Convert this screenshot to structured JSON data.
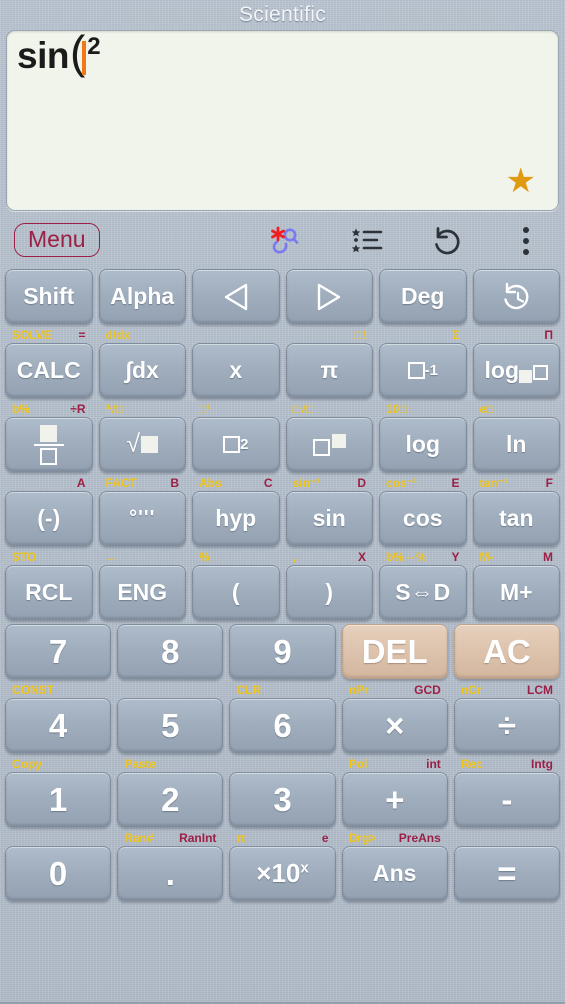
{
  "app": {
    "title": "Scientific"
  },
  "display": {
    "expression_function": "sin",
    "expression_paren": "(",
    "expression_superscript": "2",
    "cursor": "|",
    "star_icon": "star-icon",
    "star_glyph": "★",
    "background_color": "#f0f4ea",
    "star_color": "#e09a10",
    "cursor_color": "#f07818"
  },
  "toolbar": {
    "menu_label": "Menu",
    "menu_color": "#9c1f45",
    "icons": [
      {
        "name": "search-formula-icon",
        "label": "Search"
      },
      {
        "name": "list-icon",
        "label": "List"
      },
      {
        "name": "undo-icon",
        "label": "Undo"
      },
      {
        "name": "more-options-icon",
        "label": "More"
      }
    ]
  },
  "colors": {
    "shift_label": "#f0c418",
    "alpha_label": "#9c1f45",
    "key_face": "#9fadbd",
    "key_beige": "#ddc3ad",
    "background": "#b4bfcc"
  },
  "keypad": {
    "rows": [
      {
        "labels": [],
        "keys": [
          {
            "name": "key-shift",
            "text": "Shift",
            "type": "text"
          },
          {
            "name": "key-alpha",
            "text": "Alpha",
            "type": "text"
          },
          {
            "name": "key-left-arrow",
            "text": "◁",
            "type": "icon"
          },
          {
            "name": "key-right-arrow",
            "text": "▷",
            "type": "icon"
          },
          {
            "name": "key-deg",
            "text": "Deg",
            "type": "text"
          },
          {
            "name": "key-history",
            "text": "history-icon",
            "type": "icon"
          }
        ]
      },
      {
        "labels": [
          {
            "left": "SOLVE",
            "left_color": "yellow",
            "right": "=",
            "right_color": "red"
          },
          {
            "left": "d/dx",
            "left_color": "yellow",
            "right": "",
            "right_color": "red"
          },
          {
            "left": "",
            "left_color": "yellow",
            "right": "",
            "right_color": "red"
          },
          {
            "left": "",
            "left_color": "yellow",
            "right": "□!",
            "right_color": "yellow"
          },
          {
            "left": "",
            "left_color": "yellow",
            "right": "Σ",
            "right_color": "yellow"
          },
          {
            "left": "",
            "left_color": "yellow",
            "right": "Π",
            "right_color": "red"
          }
        ],
        "keys": [
          {
            "name": "key-calc",
            "text": "CALC",
            "type": "text"
          },
          {
            "name": "key-integral",
            "text": "∫dx",
            "type": "text"
          },
          {
            "name": "key-variable-x",
            "text": "x",
            "type": "text"
          },
          {
            "name": "key-pi",
            "text": "π",
            "type": "text"
          },
          {
            "name": "key-reciprocal",
            "text": "□⁻¹",
            "type": "glyph-inverse"
          },
          {
            "name": "key-log-base",
            "text": "log□□",
            "type": "glyph-logbase"
          }
        ]
      },
      {
        "labels": [
          {
            "left": "b%",
            "left_color": "yellow",
            "right": "÷R",
            "right_color": "red"
          },
          {
            "left": "³√□",
            "left_color": "yellow",
            "right": "",
            "right_color": "red"
          },
          {
            "left": "□³",
            "left_color": "yellow",
            "right": "",
            "right_color": "red"
          },
          {
            "left": "□√□",
            "left_color": "yellow",
            "right": "",
            "right_color": "red"
          },
          {
            "left": "10□",
            "left_color": "yellow",
            "right": "",
            "right_color": "red"
          },
          {
            "left": "e□",
            "left_color": "yellow",
            "right": "",
            "right_color": "red"
          }
        ],
        "keys": [
          {
            "name": "key-fraction",
            "text": "fraction",
            "type": "glyph-fraction"
          },
          {
            "name": "key-square-root",
            "text": "√□",
            "type": "glyph-sqrt"
          },
          {
            "name": "key-square",
            "text": "□²",
            "type": "glyph-square"
          },
          {
            "name": "key-power",
            "text": "□□",
            "type": "glyph-power"
          },
          {
            "name": "key-log",
            "text": "log",
            "type": "text"
          },
          {
            "name": "key-ln",
            "text": "ln",
            "type": "text"
          }
        ]
      },
      {
        "labels": [
          {
            "left": "",
            "left_color": "yellow",
            "right": "A",
            "right_color": "red"
          },
          {
            "left": "FACT",
            "left_color": "yellow",
            "right": "B",
            "right_color": "red"
          },
          {
            "left": "Abs",
            "left_color": "yellow",
            "right": "C",
            "right_color": "red"
          },
          {
            "left": "sin⁻¹",
            "left_color": "yellow",
            "right": "D",
            "right_color": "red"
          },
          {
            "left": "cos⁻¹",
            "left_color": "yellow",
            "right": "E",
            "right_color": "red"
          },
          {
            "left": "tan⁻¹",
            "left_color": "yellow",
            "right": "F",
            "right_color": "red"
          }
        ],
        "keys": [
          {
            "name": "key-negative",
            "text": "(-)",
            "type": "text"
          },
          {
            "name": "key-degrees-minutes-seconds",
            "text": "°'''",
            "type": "glyph-dms"
          },
          {
            "name": "key-hyp",
            "text": "hyp",
            "type": "text"
          },
          {
            "name": "key-sin",
            "text": "sin",
            "type": "text"
          },
          {
            "name": "key-cos",
            "text": "cos",
            "type": "text"
          },
          {
            "name": "key-tan",
            "text": "tan",
            "type": "text"
          }
        ]
      },
      {
        "labels": [
          {
            "left": "STO",
            "left_color": "yellow",
            "right": "",
            "right_color": "red"
          },
          {
            "left": "←",
            "left_color": "yellow",
            "right": "",
            "right_color": "red"
          },
          {
            "left": "%",
            "left_color": "yellow",
            "right": "",
            "right_color": "red"
          },
          {
            "left": ",",
            "left_color": "yellow",
            "right": "X",
            "right_color": "red"
          },
          {
            "left": "b%⇔%",
            "left_color": "yellow",
            "right": "Y",
            "right_color": "red"
          },
          {
            "left": "M-",
            "left_color": "yellow",
            "right": "M",
            "right_color": "red"
          }
        ],
        "keys": [
          {
            "name": "key-rcl",
            "text": "RCL",
            "type": "text"
          },
          {
            "name": "key-eng",
            "text": "ENG",
            "type": "text"
          },
          {
            "name": "key-open-paren",
            "text": "(",
            "type": "text"
          },
          {
            "name": "key-close-paren",
            "text": ")",
            "type": "text"
          },
          {
            "name": "key-s-to-d",
            "text": "S⇔D",
            "type": "text"
          },
          {
            "name": "key-memory-plus",
            "text": "M+",
            "type": "text"
          }
        ]
      },
      {
        "labels": [],
        "keys": [
          {
            "name": "key-7",
            "text": "7",
            "type": "num"
          },
          {
            "name": "key-8",
            "text": "8",
            "type": "num"
          },
          {
            "name": "key-9",
            "text": "9",
            "type": "num"
          },
          {
            "name": "key-del",
            "text": "DEL",
            "type": "beige"
          },
          {
            "name": "key-ac",
            "text": "AC",
            "type": "beige"
          }
        ]
      },
      {
        "labels": [
          {
            "left": "CONST",
            "left_color": "yellow",
            "right": "",
            "right_color": "red"
          },
          {
            "left": "",
            "left_color": "yellow",
            "right": "",
            "right_color": "red"
          },
          {
            "left": "CLR",
            "left_color": "yellow",
            "right": "",
            "right_color": "red"
          },
          {
            "left": "nPr",
            "left_color": "yellow",
            "right": "GCD",
            "right_color": "red"
          },
          {
            "left": "nCr",
            "left_color": "yellow",
            "right": "LCM",
            "right_color": "red"
          }
        ],
        "keys": [
          {
            "name": "key-4",
            "text": "4",
            "type": "num"
          },
          {
            "name": "key-5",
            "text": "5",
            "type": "num"
          },
          {
            "name": "key-6",
            "text": "6",
            "type": "num"
          },
          {
            "name": "key-multiply",
            "text": "×",
            "type": "num"
          },
          {
            "name": "key-divide",
            "text": "÷",
            "type": "num"
          }
        ]
      },
      {
        "labels": [
          {
            "left": "Copy",
            "left_color": "yellow",
            "right": "",
            "right_color": "red"
          },
          {
            "left": "Paste",
            "left_color": "yellow",
            "right": "",
            "right_color": "red"
          },
          {
            "left": "",
            "left_color": "yellow",
            "right": "",
            "right_color": "red"
          },
          {
            "left": "Pol",
            "left_color": "yellow",
            "right": "int",
            "right_color": "red"
          },
          {
            "left": "Rec",
            "left_color": "yellow",
            "right": "Intg",
            "right_color": "red"
          }
        ],
        "keys": [
          {
            "name": "key-1",
            "text": "1",
            "type": "num"
          },
          {
            "name": "key-2",
            "text": "2",
            "type": "num"
          },
          {
            "name": "key-3",
            "text": "3",
            "type": "num"
          },
          {
            "name": "key-plus",
            "text": "+",
            "type": "num"
          },
          {
            "name": "key-minus",
            "text": "-",
            "type": "num"
          }
        ]
      },
      {
        "labels": [
          {
            "left": "",
            "left_color": "yellow",
            "right": "",
            "right_color": "red"
          },
          {
            "left": "Ran#",
            "left_color": "yellow",
            "right": "RanInt",
            "right_color": "red"
          },
          {
            "left": "π",
            "left_color": "yellow",
            "right": "e",
            "right_color": "red"
          },
          {
            "left": "Drg>",
            "left_color": "yellow",
            "right": "PreAns",
            "right_color": "red"
          },
          {
            "left": "",
            "left_color": "yellow",
            "right": "",
            "right_color": "red"
          }
        ],
        "keys": [
          {
            "name": "key-0",
            "text": "0",
            "type": "num"
          },
          {
            "name": "key-decimal-point",
            "text": ".",
            "type": "num"
          },
          {
            "name": "key-times-ten-power",
            "text": "×10ˣ",
            "type": "glyph-exp"
          },
          {
            "name": "key-ans",
            "text": "Ans",
            "type": "text"
          },
          {
            "name": "key-equals",
            "text": "=",
            "type": "num"
          }
        ]
      }
    ]
  }
}
